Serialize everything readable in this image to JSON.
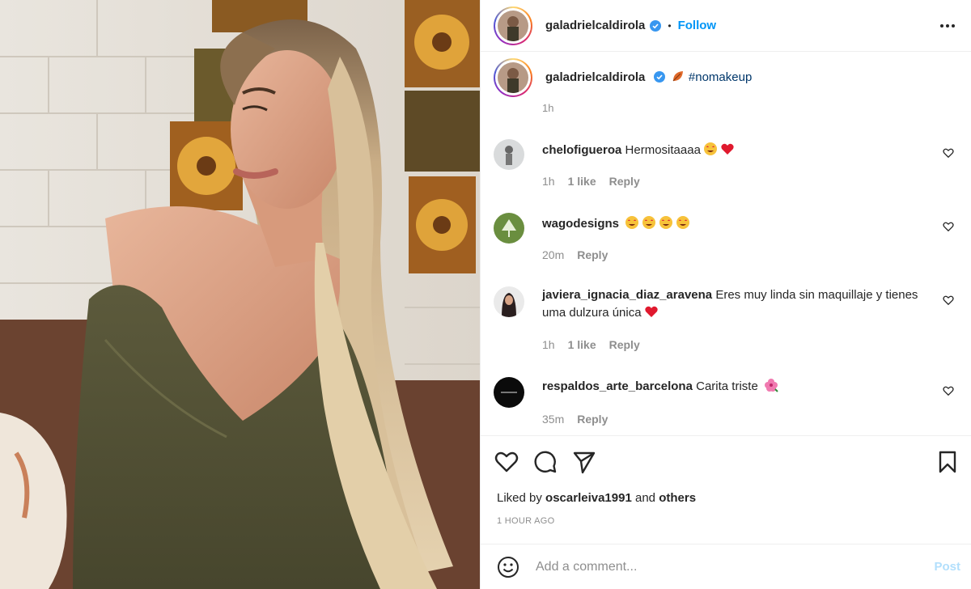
{
  "header": {
    "username": "galadrielcaldirola",
    "separator": "•",
    "follow_label": "Follow",
    "more_icon": "more-horizontal-icon"
  },
  "caption": {
    "username": "galadrielcaldirola",
    "hashtag": "#nomakeup",
    "time": "1h"
  },
  "comments": [
    {
      "username": "chelofigueroa",
      "text": "Hermositaaaa",
      "time": "1h",
      "likes": "1 like",
      "reply": "Reply"
    },
    {
      "username": "wagodesigns",
      "text": "",
      "time": "20m",
      "likes": "",
      "reply": "Reply"
    },
    {
      "username": "javiera_ignacia_diaz_aravena",
      "text": "Eres muy linda sin maquillaje y tienes uma dulzura única",
      "time": "1h",
      "likes": "1 like",
      "reply": "Reply"
    },
    {
      "username": "respaldos_arte_barcelona",
      "text": "Carita triste",
      "time": "35m",
      "likes": "",
      "reply": "Reply"
    }
  ],
  "actions": {
    "liked_prefix": "Liked by",
    "liked_user": "oscarleiva1991",
    "liked_and": "and",
    "liked_others": "others",
    "timestamp": "1 HOUR AGO"
  },
  "add_comment": {
    "placeholder": "Add a comment...",
    "post_label": "Post"
  },
  "colors": {
    "accent": "#0095f6",
    "post_disabled": "#b2dffc",
    "muted": "#8e8e8e",
    "hashtag": "#00376b"
  }
}
